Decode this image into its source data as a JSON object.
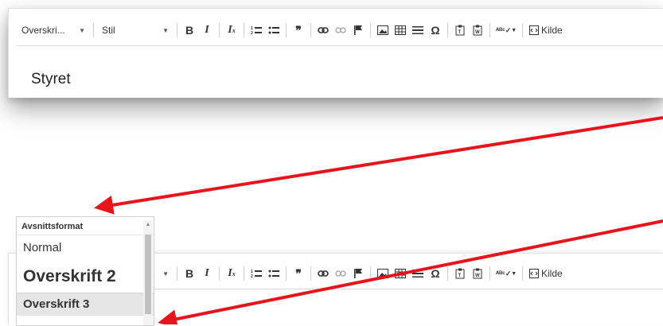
{
  "toolbar": {
    "format_value": "Overskri...",
    "style_value": "Stil",
    "source_label": "Kilde"
  },
  "editor": {
    "content_text": "Styret"
  },
  "format_dropdown": {
    "header": "Avsnittsformat",
    "items": [
      "Normal",
      "Overskrift 2",
      "Overskrift 3"
    ],
    "highlighted": "Overskrift 3"
  },
  "annotation_color": "#e8141c"
}
